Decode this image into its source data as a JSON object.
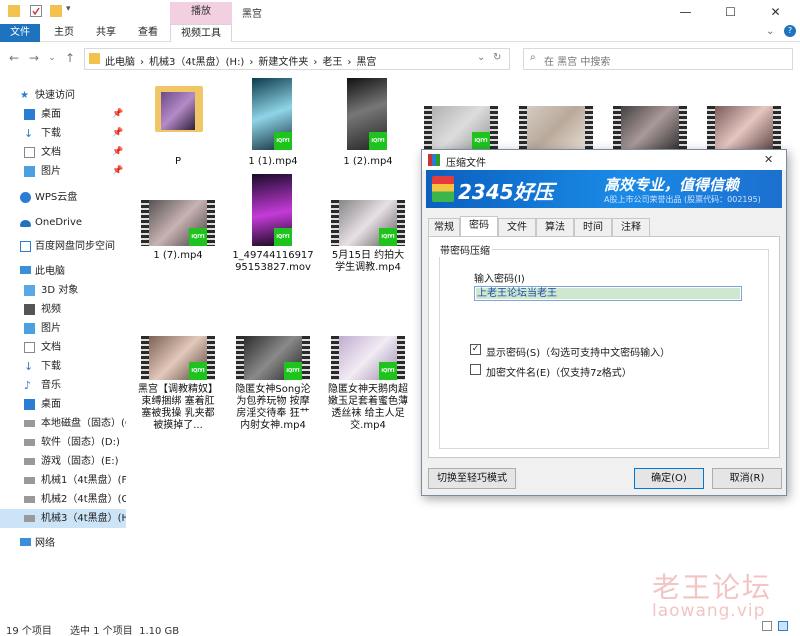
{
  "titlebar": {
    "context_tab": "播放",
    "window_title": "黑宫",
    "min": "—",
    "max": "☐",
    "close": "✕"
  },
  "ribbon": {
    "tabs": [
      "文件",
      "主页",
      "共享",
      "查看",
      "视频工具"
    ]
  },
  "address": {
    "crumbs": [
      "此电脑",
      "›",
      "机械3（4t黑盘）(H:)",
      "›",
      "新建文件夹",
      "›",
      "老王",
      "›",
      "黑宫"
    ],
    "search_placeholder": "在 黑宫 中搜索"
  },
  "sidebar": {
    "items": [
      {
        "label": "快速访问"
      },
      {
        "label": "桌面",
        "pin": "📌"
      },
      {
        "label": "下载",
        "pin": "📌"
      },
      {
        "label": "文档",
        "pin": "📌"
      },
      {
        "label": "图片",
        "pin": "📌"
      },
      {
        "label": "WPS云盘"
      },
      {
        "label": "OneDrive"
      },
      {
        "label": "百度网盘同步空间"
      },
      {
        "label": "此电脑"
      },
      {
        "label": "3D 对象"
      },
      {
        "label": "视频"
      },
      {
        "label": "图片"
      },
      {
        "label": "文档"
      },
      {
        "label": "下载"
      },
      {
        "label": "音乐"
      },
      {
        "label": "桌面"
      },
      {
        "label": "本地磁盘（固态）(C"
      },
      {
        "label": "软件（固态）(D:)"
      },
      {
        "label": "游戏（固态）(E:)"
      },
      {
        "label": "机械1（4t黑盘）(F"
      },
      {
        "label": "机械2（4t黑盘）(G"
      },
      {
        "label": "机械3（4t黑盘）(H"
      },
      {
        "label": "网络"
      }
    ]
  },
  "files": [
    {
      "name": "P"
    },
    {
      "name": "1 (1).mp4"
    },
    {
      "name": "1 (2).mp4"
    },
    {
      "name": ""
    },
    {
      "name": ""
    },
    {
      "name": ""
    },
    {
      "name": ""
    },
    {
      "name": "1 (7).mp4"
    },
    {
      "name": "1_4974411691795153827.mov"
    },
    {
      "name": "5月15日 约拍大学生调教.mp4"
    },
    {
      "name": "黑宫【调教精奴】束缚捆绑 塞着肛塞被我操 乳夹都被摸掉了..."
    },
    {
      "name": "隐匿女神Song沦为包养玩物 按摩房淫交待奉 狂艹内射女神.mp4"
    },
    {
      "name": "隐匿女神天鹅肉超嫩玉足套着蜜色薄透丝袜 给主人足交.mp4"
    }
  ],
  "status": {
    "count": "19 个项目",
    "selected": "选中 1 个项目  1.10 GB"
  },
  "watermark": {
    "line1": "老王论坛",
    "line2": "laowang.vip"
  },
  "dialog": {
    "title": "压缩文件",
    "close": "✕",
    "banner": {
      "logo": "2345好压",
      "slogan": "高效专业，值得信赖",
      "sub": "A股上市公司荣誉出品 (股票代码：002195)"
    },
    "tabs": [
      "常规",
      "密码",
      "文件",
      "算法",
      "时间",
      "注释"
    ],
    "group_label": "带密码压缩",
    "input_label": "输入密码(I)",
    "password_value": "上老王论坛当老王",
    "show_password_label": "显示密码(S)（勾选可支持中文密码输入）",
    "show_password_checked": true,
    "encrypt_names_label": "加密文件名(E)（仅支持7z格式）",
    "encrypt_names_checked": false,
    "switch_button": "切换至轻巧模式",
    "ok_button": "确定(O)",
    "cancel_button": "取消(R)",
    "accent": "#0b5fbf"
  }
}
